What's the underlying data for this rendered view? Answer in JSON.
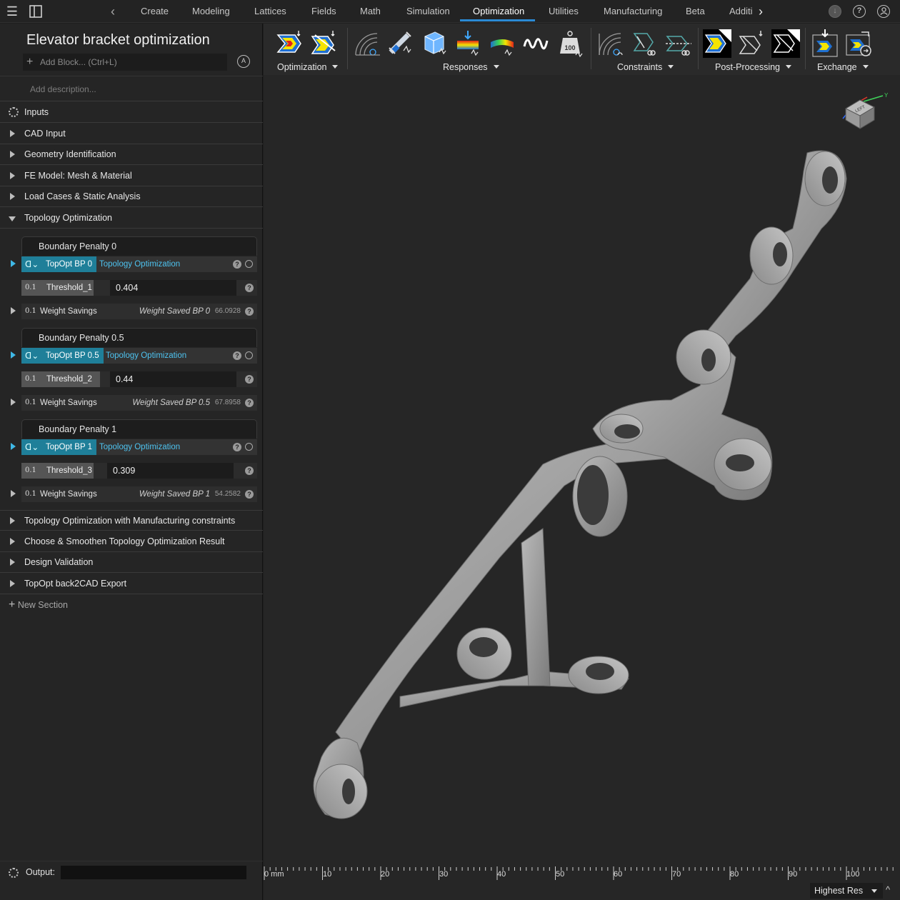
{
  "topbar": {
    "tabs": [
      "Create",
      "Modeling",
      "Lattices",
      "Fields",
      "Math",
      "Simulation",
      "Optimization",
      "Utilities",
      "Manufacturing",
      "Beta",
      "Additi"
    ],
    "active_tab": "Optimization",
    "help_label": "?"
  },
  "project": {
    "title": "Elevator bracket optimization",
    "add_block_placeholder": "Add Block... (Ctrl+L)",
    "description_placeholder": "Add description..."
  },
  "sections": {
    "inputs": "Inputs",
    "cad_input": "CAD Input",
    "geometry_identification": "Geometry Identification",
    "fe_model": "FE Model: Mesh & Material",
    "load_cases": "Load Cases & Static Analysis",
    "topology_optimization": "Topology Optimization",
    "topo_mfg": "Topology Optimization with Manufacturing constraints",
    "choose_smoothen": "Choose & Smoothen Topology Optimization Result",
    "design_validation": "Design Validation",
    "back2cad": "TopOpt back2CAD Export",
    "new_section": "New Section"
  },
  "groups": [
    {
      "title": "Boundary Penalty 0",
      "topopt": "TopOpt BP 0",
      "topopt_type": "Topology Optimization",
      "threshold_name": "Threshold_1",
      "threshold_value": "0.404",
      "ws_label": "Weight Savings",
      "ws_result": "Weight Saved BP 0",
      "ws_value": "66.0928"
    },
    {
      "title": "Boundary Penalty 0.5",
      "topopt": "TopOpt BP 0.5",
      "topopt_type": "Topology Optimization",
      "threshold_name": "Threshold_2",
      "threshold_value": "0.44",
      "ws_label": "Weight Savings",
      "ws_result": "Weight Saved BP 0.5",
      "ws_value": "67.8958"
    },
    {
      "title": "Boundary Penalty 1",
      "topopt": "TopOpt BP 1",
      "topopt_type": "Topology Optimization",
      "threshold_name": "Threshold_3",
      "threshold_value": "0.309",
      "ws_label": "Weight Savings",
      "ws_result": "Weight Saved BP 1",
      "ws_value": "54.2582"
    }
  ],
  "chip_icon_text": "0.1",
  "ribbon": {
    "groups": [
      "Optimization",
      "Responses",
      "Constraints",
      "Post-Processing",
      "Exchange"
    ],
    "weight_icon_text": "100"
  },
  "axis_cube": {
    "face_label": "LEFT",
    "axis_label": "Y"
  },
  "ruler": {
    "labels": [
      "0 mm",
      "10",
      "20",
      "30",
      "40",
      "50",
      "60",
      "70",
      "80",
      "90",
      "100"
    ]
  },
  "output": {
    "label": "Output:"
  },
  "status": {
    "resolution": "Highest Res"
  },
  "colors": {
    "accent": "#2a8ad4",
    "chip": "#1f7f99",
    "link": "#4ec3f0",
    "part": "#9a9a9a"
  }
}
